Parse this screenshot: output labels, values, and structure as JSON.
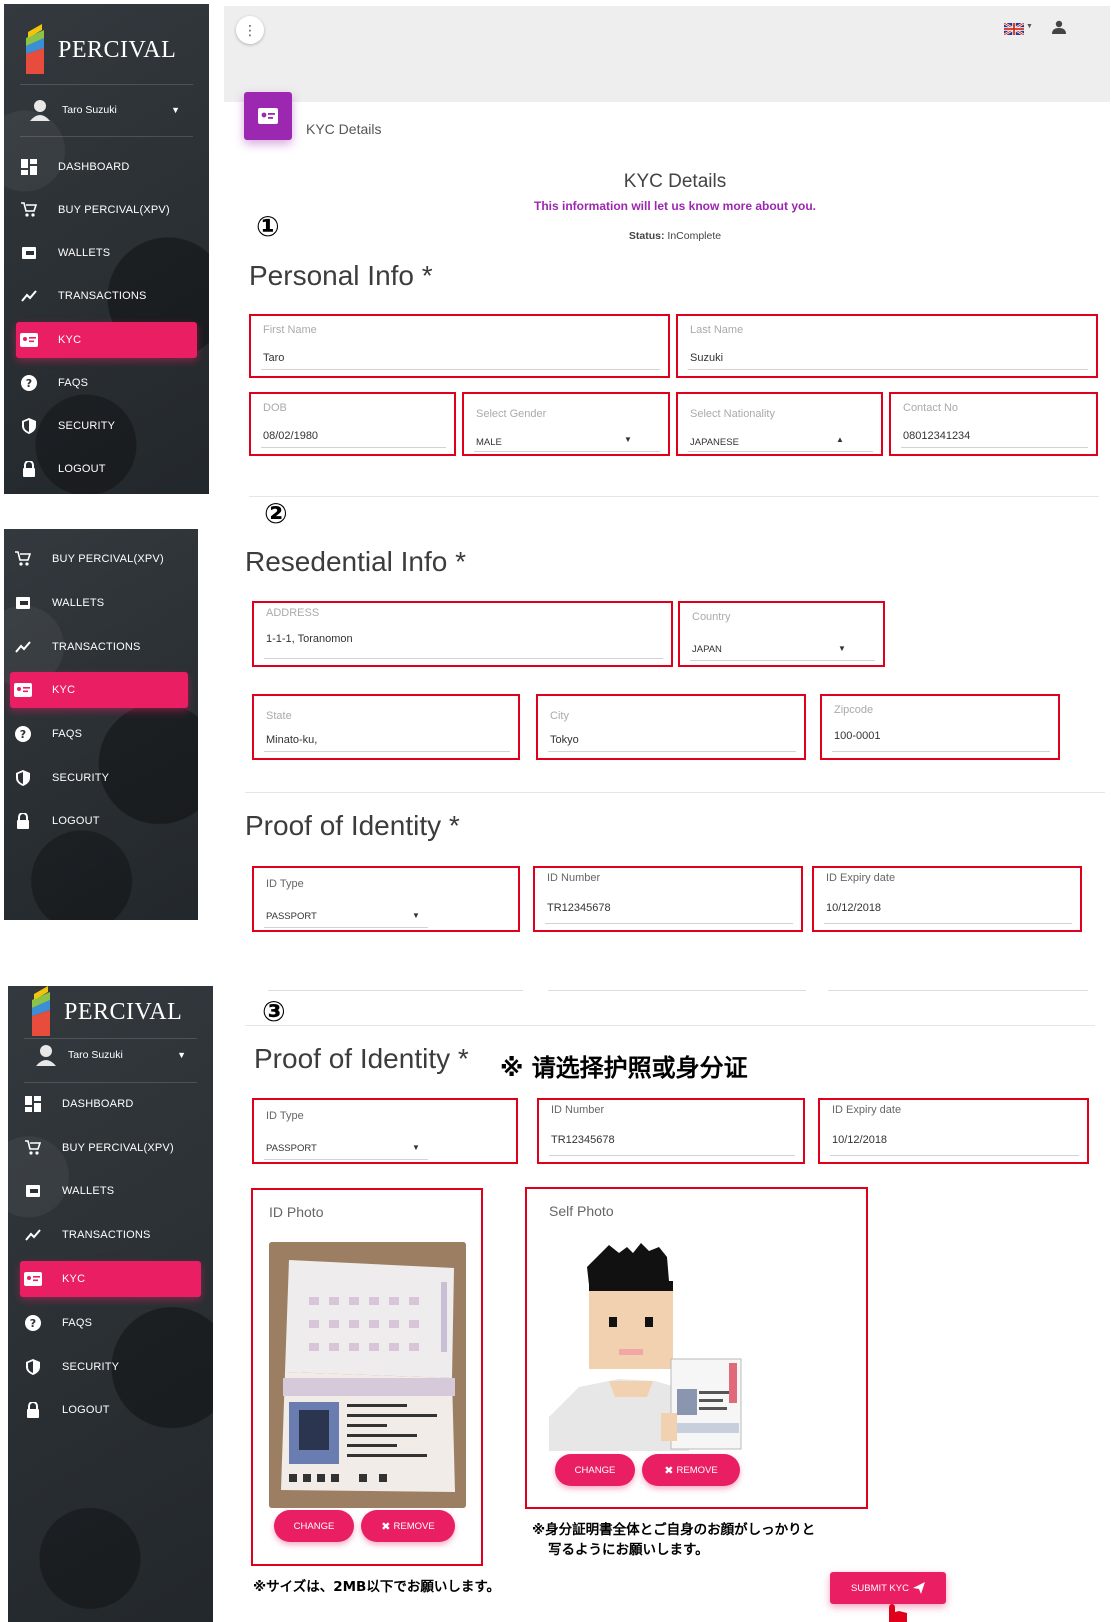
{
  "brand": {
    "name": "PERCIVAL"
  },
  "user": {
    "name": "Taro Suzuki"
  },
  "sidebar": {
    "items": [
      {
        "label": "DASHBOARD",
        "icon": "dashboard-icon"
      },
      {
        "label": "BUY PERCIVAL(XPV)",
        "icon": "cart-icon"
      },
      {
        "label": "WALLETS",
        "icon": "wallet-icon"
      },
      {
        "label": "TRANSACTIONS",
        "icon": "chart-line-icon"
      },
      {
        "label": "KYC",
        "icon": "id-card-icon"
      },
      {
        "label": "FAQS",
        "icon": "help-icon"
      },
      {
        "label": "SECURITY",
        "icon": "shield-icon"
      },
      {
        "label": "LOGOUT",
        "icon": "lock-icon"
      }
    ],
    "active": "KYC"
  },
  "topbar": {
    "menu_icon": "more-vert-icon",
    "lang_icon": "uk-flag-icon",
    "profile_icon": "person-icon"
  },
  "card": {
    "header_title": "KYC Details"
  },
  "kyc": {
    "title": "KYC Details",
    "subtitle": "This information will let us know more about you.",
    "status_label": "Status:",
    "status_value": "InComplete"
  },
  "steps": {
    "one": "①",
    "two": "②",
    "three": "③"
  },
  "personal": {
    "title": "Personal Info *",
    "first_name": {
      "label": "First Name",
      "value": "Taro"
    },
    "last_name": {
      "label": "Last Name",
      "value": "Suzuki"
    },
    "dob": {
      "label": "DOB",
      "value": "08/02/1980"
    },
    "gender": {
      "label": "Select Gender",
      "value": "MALE"
    },
    "nationality": {
      "label": "Select Nationality",
      "value": "JAPANESE"
    },
    "contact": {
      "label": "Contact No",
      "value": "08012341234"
    }
  },
  "residential": {
    "title": "Resedential Info *",
    "address": {
      "label": "ADDRESS",
      "value": "1-1-1, Toranomon"
    },
    "country": {
      "label": "Country",
      "value": "JAPAN"
    },
    "state": {
      "label": "State",
      "value": "Minato-ku,"
    },
    "city": {
      "label": "City",
      "value": "Tokyo"
    },
    "zipcode": {
      "label": "Zipcode",
      "value": "100-0001"
    }
  },
  "identity": {
    "title": "Proof of Identity *",
    "id_type": {
      "label": "ID Type",
      "value": "PASSPORT"
    },
    "id_number": {
      "label": "ID Number",
      "value": "TR12345678"
    },
    "id_expiry": {
      "label": "ID Expiry date",
      "value": "10/12/2018"
    }
  },
  "identity3": {
    "title": "Proof of Identity *",
    "note": "※ 请选择护照或身分证"
  },
  "photos": {
    "id_photo_label": "ID Photo",
    "self_photo_label": "Self Photo",
    "change": "CHANGE",
    "remove": "REMOVE",
    "self_note_line1": "※身分証明書全体とご自身のお顔がしっかりと",
    "self_note_line2": "写るようにお願いします。",
    "size_note": "※サイズは、2MB以下でお願いします。"
  },
  "submit": {
    "label": "SUBMIT KYC"
  },
  "colors": {
    "accent": "#e91e63",
    "card_icon": "#9c27b0",
    "highlight": "#e0001b",
    "subtitle": "#9c27b0"
  }
}
